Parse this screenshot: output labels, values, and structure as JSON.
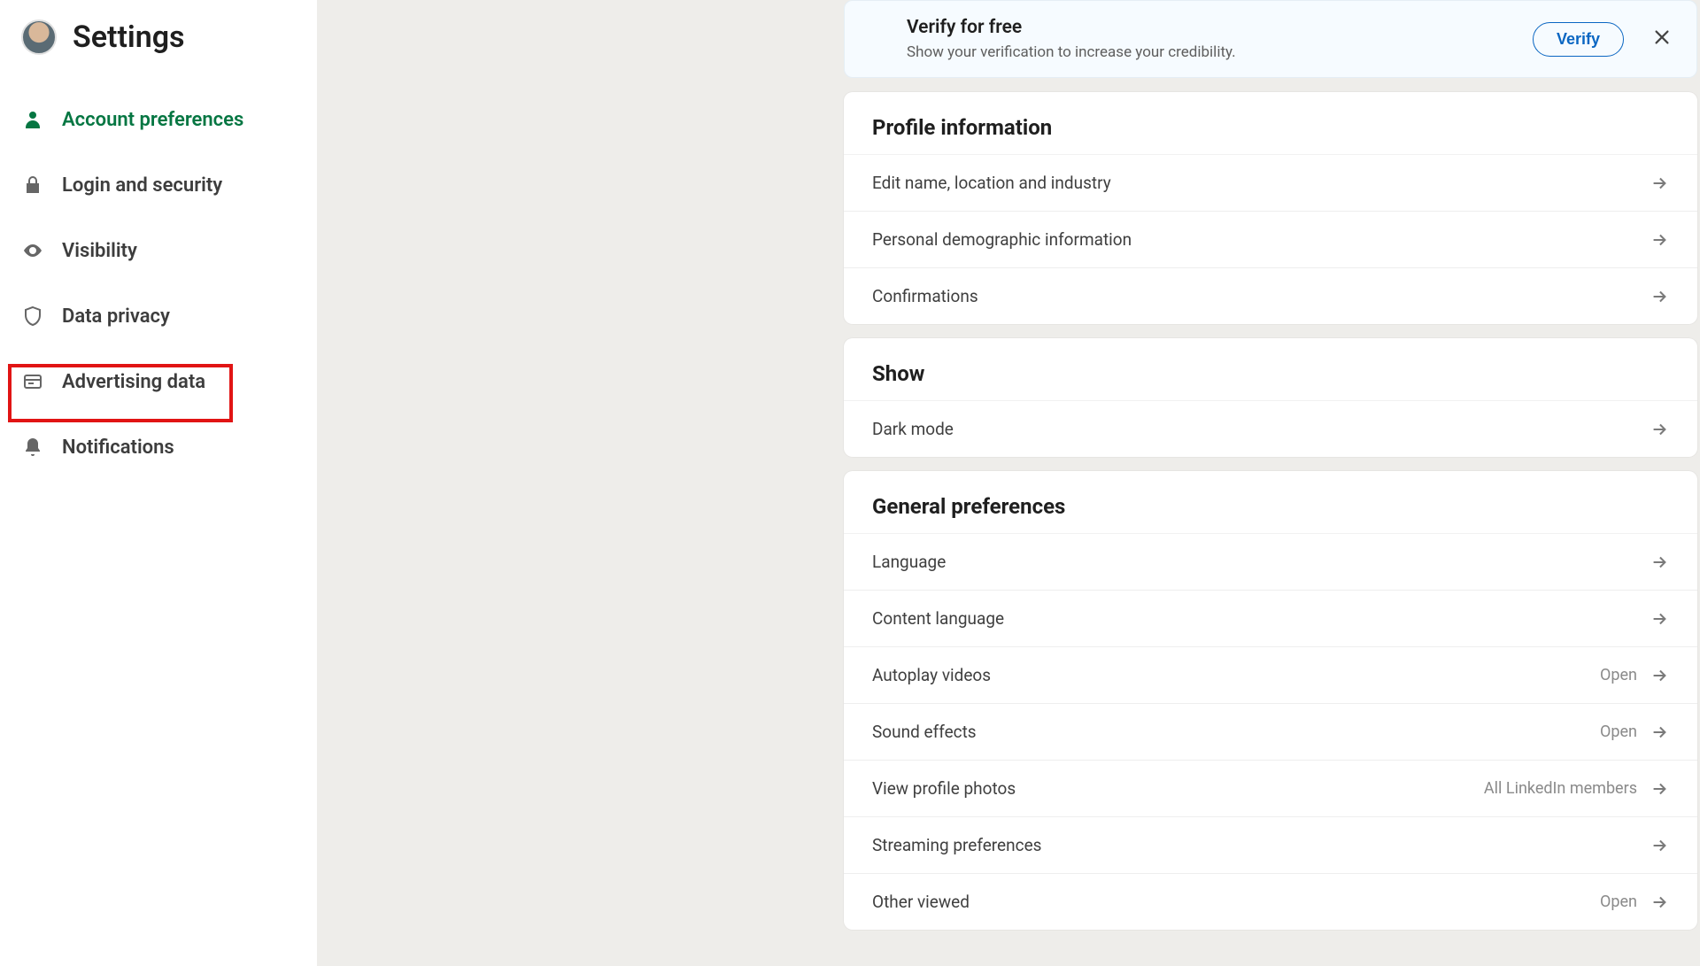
{
  "page_title": "Settings",
  "sidebar": {
    "items": [
      {
        "label": "Account preferences",
        "icon": "person",
        "active": true
      },
      {
        "label": "Login and security",
        "icon": "lock"
      },
      {
        "label": "Visibility",
        "icon": "eye"
      },
      {
        "label": "Data privacy",
        "icon": "shield",
        "highlighted": true
      },
      {
        "label": "Advertising data",
        "icon": "card"
      },
      {
        "label": "Notifications",
        "icon": "bell"
      }
    ]
  },
  "banner": {
    "title": "Verify for free",
    "subtitle": "Show your verification to increase your credibility.",
    "button": "Verify"
  },
  "sections": [
    {
      "title": "Profile information",
      "items": [
        {
          "label": "Edit name, location and industry"
        },
        {
          "label": "Personal demographic information"
        },
        {
          "label": "Confirmations"
        }
      ]
    },
    {
      "title": "Show",
      "items": [
        {
          "label": "Dark mode"
        }
      ]
    },
    {
      "title": "General preferences",
      "items": [
        {
          "label": "Language"
        },
        {
          "label": "Content language"
        },
        {
          "label": "Autoplay videos",
          "value": "Open"
        },
        {
          "label": "Sound effects",
          "value": "Open"
        },
        {
          "label": "View profile photos",
          "value": "All LinkedIn members"
        },
        {
          "label": "Streaming preferences"
        },
        {
          "label": "Other viewed",
          "value": "Open"
        }
      ]
    }
  ]
}
